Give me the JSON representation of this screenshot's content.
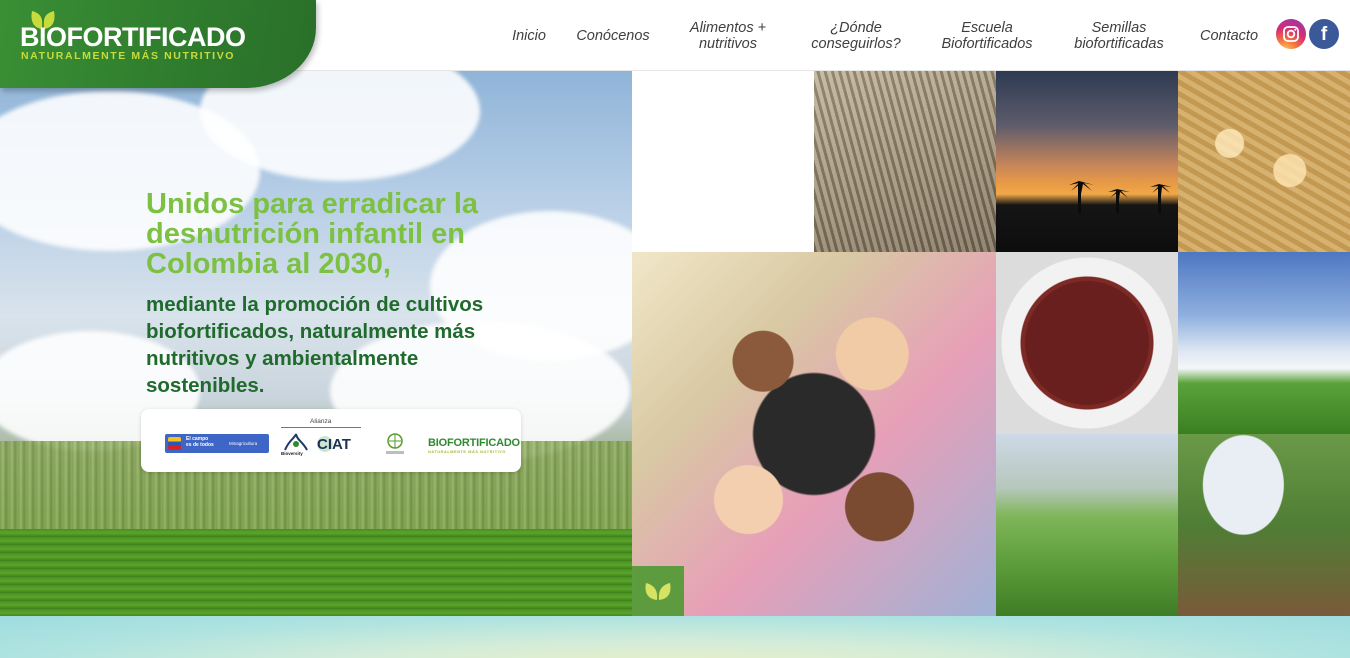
{
  "brand": {
    "name": "BIOFORTIFICADO",
    "tagline": "NATURALMENTE MÁS NUTRITIVO",
    "color_primary": "#2f7d2e",
    "color_tagline": "#c7dc3c"
  },
  "nav": {
    "items": [
      {
        "label": "Inicio"
      },
      {
        "label": "Conócenos"
      },
      {
        "label_line1": "Alimentos +",
        "label_line2": "nutritivos"
      },
      {
        "label_line1": "¿Dónde",
        "label_line2": "conseguirlos?"
      },
      {
        "label_line1": "Escuela",
        "label_line2": "Biofortificados"
      },
      {
        "label_line1": "Semillas",
        "label_line2": "biofortificadas"
      },
      {
        "label": "Contacto"
      }
    ],
    "social": [
      {
        "icon": "instagram-icon"
      },
      {
        "icon": "facebook-icon",
        "glyph": "f"
      }
    ]
  },
  "hero": {
    "headline": "Unidos para erradicar la desnutrición infantil en Colombia al 2030,",
    "subline": "mediante la promoción de cultivos biofortificados, naturalmente más nutritivos y ambientalmente sostenibles.",
    "headline_color": "#7cc142",
    "subline_color": "#1f6a2c",
    "partners": {
      "alliance_label": "Alianza",
      "gov_text_line1": "El campo",
      "gov_text_line2": "es de todos",
      "gov_ministry": "Minagricultura",
      "bioversity_text": "Bioversity",
      "ciat_text": "CIAT",
      "brand_text": "BIOFORTIFICADO",
      "brand_tag": "NATURALMENTE MÁS NUTRITIVO"
    }
  }
}
